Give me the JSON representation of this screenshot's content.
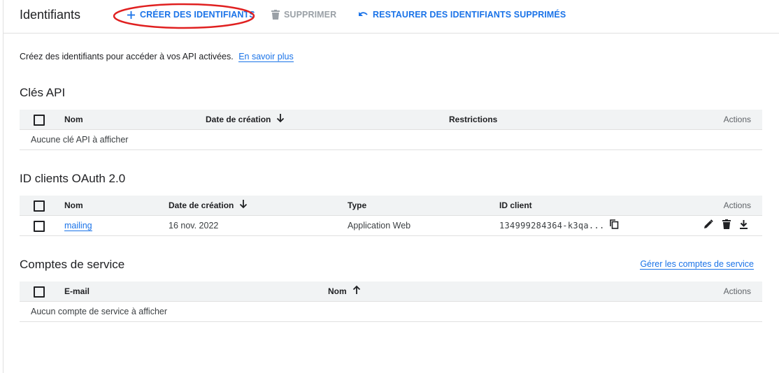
{
  "header": {
    "title": "Identifiants",
    "create_label": "CRÉER DES IDENTIFIANTS",
    "delete_label": "SUPPRIMER",
    "restore_label": "RESTAURER DES IDENTIFIANTS SUPPRIMÉS"
  },
  "intro": {
    "text": "Créez des identifiants pour accéder à vos API activées.",
    "link": "En savoir plus"
  },
  "api_keys": {
    "title": "Clés API",
    "columns": [
      "Nom",
      "Date de création",
      "Restrictions",
      "Actions"
    ],
    "empty_text": "Aucune clé API à afficher"
  },
  "oauth": {
    "title": "ID clients OAuth 2.0",
    "columns": [
      "Nom",
      "Date de création",
      "Type",
      "ID client",
      "Actions"
    ],
    "rows": [
      {
        "name": "mailing",
        "date": "16 nov. 2022",
        "type": "Application Web",
        "client_id": "134999284364-k3qa..."
      }
    ]
  },
  "service_accounts": {
    "title": "Comptes de service",
    "manage_link": "Gérer les comptes de service",
    "columns": [
      "E-mail",
      "Nom",
      "Actions"
    ],
    "empty_text": "Aucun compte de service à afficher"
  },
  "icons": {
    "create": "plus-icon",
    "delete": "trash-icon",
    "restore": "undo-icon",
    "sort_desc": "arrow-down-icon",
    "sort_asc": "arrow-up-icon",
    "copy": "copy-icon",
    "edit": "pencil-icon",
    "row_delete": "trash-icon",
    "download": "download-icon"
  },
  "colors": {
    "accent": "#1a73e8",
    "disabled": "#9aa0a6",
    "annotation": "#e02020",
    "header_bg": "#f1f3f4"
  }
}
